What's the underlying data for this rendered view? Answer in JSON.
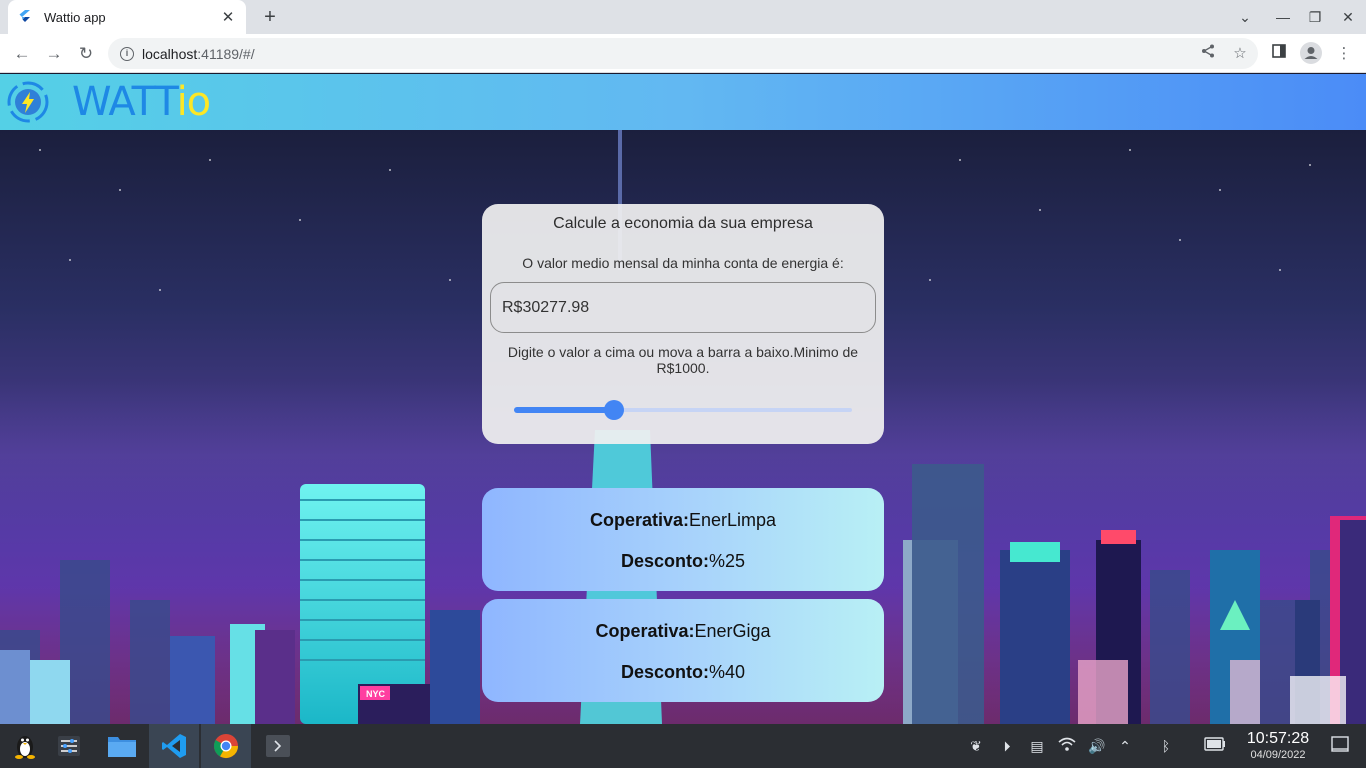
{
  "browser": {
    "tab_title": "Wattio app",
    "tab_close": "✕",
    "new_tab": "+",
    "url_host": "localhost",
    "url_rest": ":41189/#/",
    "win_minimize": "—",
    "win_restore": "❐",
    "win_close": "✕",
    "tab_search": "⌄"
  },
  "appbar": {
    "brand_main": "WATT",
    "brand_suffix": "io"
  },
  "calculator": {
    "title": "Calcule a economia da sua empresa",
    "subtitle": "O valor medio mensal da minha conta de energia é:",
    "input_value": "R$30277.98",
    "hint": "Digite o valor a cima ou mova a barra a baixo.Minimo de R$1000.",
    "slider_fraction": 0.296
  },
  "cooperatives": [
    {
      "coop_label": "Coperativa:",
      "coop_name": "EnerLimpa",
      "discount_label": "Desconto:",
      "discount_value": "%25"
    },
    {
      "coop_label": "Coperativa:",
      "coop_name": "EnerGiga",
      "discount_label": "Desconto:",
      "discount_value": "%40"
    }
  ],
  "scene": {
    "sign_text": "NYC"
  },
  "taskbar": {
    "time": "10:57:28",
    "date": "04/09/2022"
  },
  "colors": {
    "accent": "#4285f4",
    "brand_blue": "#1e88e5",
    "brand_yellow": "#fde725"
  }
}
